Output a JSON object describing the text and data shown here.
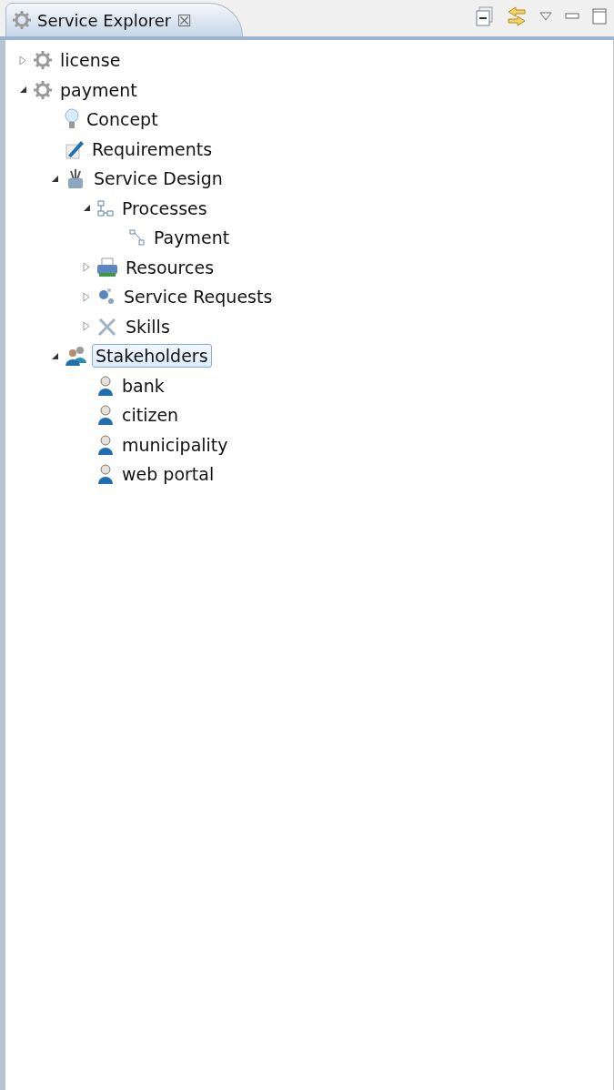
{
  "view": {
    "title": "Service Explorer",
    "close": "☒"
  },
  "tree": [
    {
      "label": "license",
      "kind": "gear",
      "expandable": true,
      "expanded": false,
      "selected": false
    },
    {
      "label": "payment",
      "kind": "gear",
      "expandable": true,
      "expanded": true,
      "selected": false,
      "children": [
        {
          "label": "Concept",
          "kind": "bulb",
          "expandable": false,
          "expanded": false,
          "selected": false
        },
        {
          "label": "Requirements",
          "kind": "pencil",
          "expandable": false,
          "expanded": false,
          "selected": false
        },
        {
          "label": "Service Design",
          "kind": "design",
          "expandable": true,
          "expanded": true,
          "selected": false,
          "children": [
            {
              "label": "Processes",
              "kind": "process",
              "expandable": true,
              "expanded": true,
              "selected": false,
              "children": [
                {
                  "label": "Payment",
                  "kind": "flow",
                  "expandable": false,
                  "expanded": false,
                  "selected": false
                }
              ]
            },
            {
              "label": "Resources",
              "kind": "printer",
              "expandable": true,
              "expanded": false,
              "selected": false
            },
            {
              "label": "Service Requests",
              "kind": "request",
              "expandable": true,
              "expanded": false,
              "selected": false
            },
            {
              "label": "Skills",
              "kind": "tools",
              "expandable": true,
              "expanded": false,
              "selected": false
            }
          ]
        },
        {
          "label": "Stakeholders",
          "kind": "group",
          "expandable": true,
          "expanded": true,
          "selected": true,
          "children": [
            {
              "label": "bank",
              "kind": "person",
              "expandable": false,
              "expanded": false,
              "selected": false
            },
            {
              "label": "citizen",
              "kind": "person",
              "expandable": false,
              "expanded": false,
              "selected": false
            },
            {
              "label": "municipality",
              "kind": "person",
              "expandable": false,
              "expanded": false,
              "selected": false
            },
            {
              "label": "web portal",
              "kind": "person",
              "expandable": false,
              "expanded": false,
              "selected": false
            }
          ]
        }
      ]
    }
  ]
}
